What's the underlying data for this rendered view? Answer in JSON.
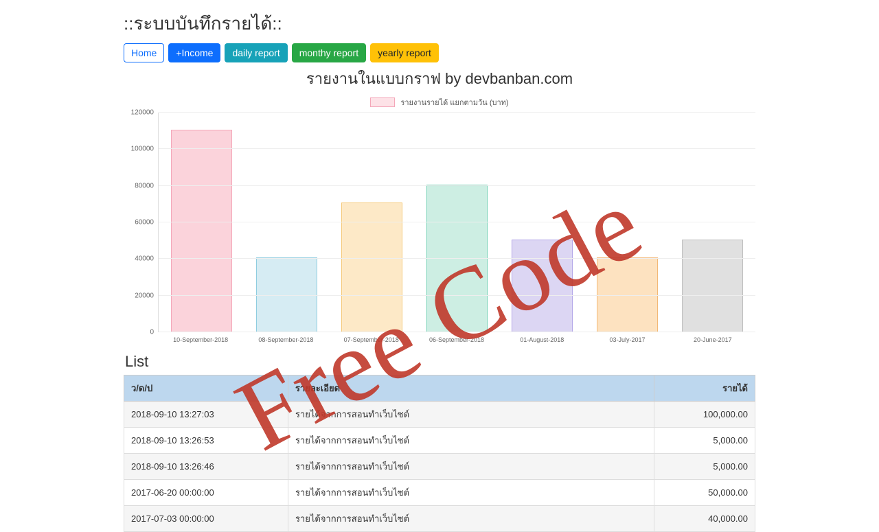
{
  "header": {
    "title": "::ระบบบันทึกรายได้::",
    "subtitle": "รายงานในแบบกราฟ by devbanban.com"
  },
  "nav": {
    "home": "Home",
    "income": "+Income",
    "daily": "daily report",
    "monthly": "monthy report",
    "yearly": "yearly report"
  },
  "legend": {
    "label": "รายงานรายได้ แยกตามวัน (บาท)"
  },
  "watermark": "Free Code",
  "list": {
    "title": "List",
    "headers": {
      "date": "ว/ด/ป",
      "detail": "รายละเอียด",
      "income": "รายได้"
    },
    "rows": [
      {
        "date": "2018-09-10 13:27:03",
        "detail": "รายได้จากการสอนทำเว็บไซต์",
        "income": "100,000.00"
      },
      {
        "date": "2018-09-10 13:26:53",
        "detail": "รายได้จากการสอนทำเว็บไซต์",
        "income": "5,000.00"
      },
      {
        "date": "2018-09-10 13:26:46",
        "detail": "รายได้จากการสอนทำเว็บไซต์",
        "income": "5,000.00"
      },
      {
        "date": "2017-06-20 00:00:00",
        "detail": "รายได้จากการสอนทำเว็บไซต์",
        "income": "50,000.00"
      },
      {
        "date": "2017-07-03 00:00:00",
        "detail": "รายได้จากการสอนทำเว็บไซต์",
        "income": "40,000.00"
      }
    ]
  },
  "chart_data": {
    "type": "bar",
    "title": "รายงานรายได้ แยกตามวัน (บาท)",
    "xlabel": "",
    "ylabel": "",
    "ylim": [
      0,
      120000
    ],
    "yticks": [
      0,
      20000,
      40000,
      60000,
      80000,
      100000,
      120000
    ],
    "categories": [
      "10-September-2018",
      "08-September-2018",
      "07-September-2018",
      "06-September-2018",
      "01-August-2018",
      "03-July-2017",
      "20-June-2017"
    ],
    "values": [
      110000,
      40000,
      70000,
      80000,
      50000,
      40000,
      50000
    ],
    "colors": [
      "#fbd3db",
      "#d6ecf3",
      "#fde9c7",
      "#cdeee3",
      "#dcd6f3",
      "#fde2c0",
      "#e0e0e0"
    ],
    "borders": [
      "#f4a7b9",
      "#8fcde0",
      "#f5ca7b",
      "#79d3b8",
      "#b3a6e8",
      "#f2b877",
      "#bfbfbf"
    ]
  }
}
